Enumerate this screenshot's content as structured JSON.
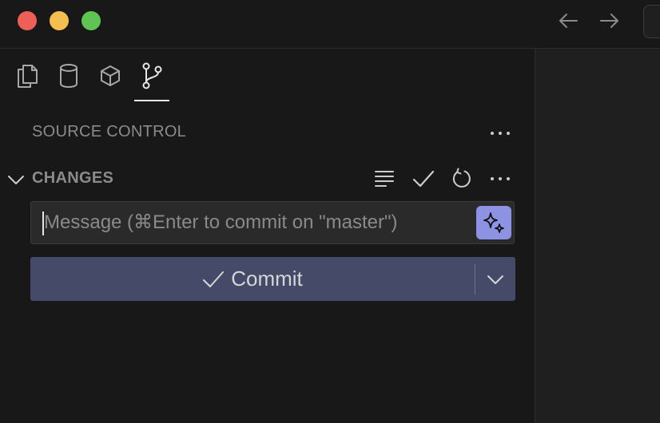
{
  "window": {
    "controls": [
      "close",
      "minimize",
      "zoom"
    ]
  },
  "titlebar": {
    "back_icon": "arrow-left-icon",
    "forward_icon": "arrow-right-icon"
  },
  "activity_tabs": [
    {
      "name": "explorer",
      "icon": "files-icon",
      "active": false
    },
    {
      "name": "database",
      "icon": "database-icon",
      "active": false
    },
    {
      "name": "extensions",
      "icon": "cube-icon",
      "active": false
    },
    {
      "name": "source-control",
      "icon": "git-branch-icon",
      "active": true
    }
  ],
  "sidebar": {
    "title": "SOURCE CONTROL",
    "changes": {
      "title": "CHANGES",
      "actions": [
        "list-view-icon",
        "check-icon",
        "refresh-icon",
        "more-icon"
      ]
    },
    "message": {
      "placeholder": "Message (⌘Enter to commit on \"master\")",
      "value": ""
    },
    "commit": {
      "label": "Commit"
    }
  },
  "colors": {
    "background": "#181818",
    "commit_button": "#464a69",
    "sparkle_button": "#8d93e2"
  }
}
